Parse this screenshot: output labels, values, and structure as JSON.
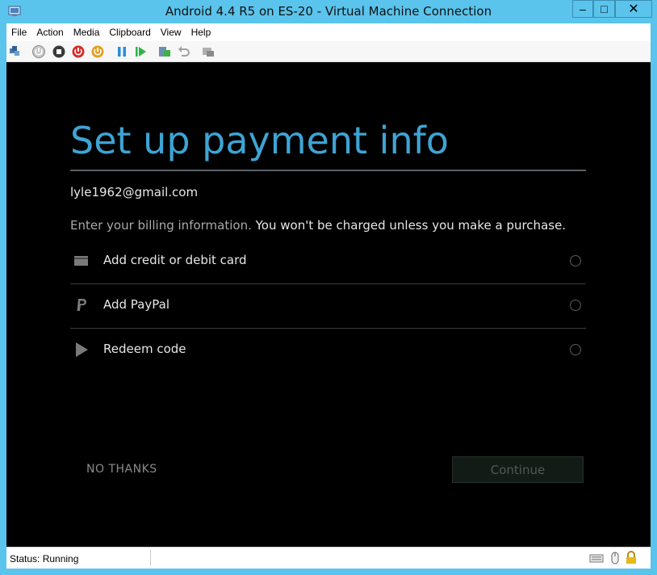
{
  "window": {
    "title": "Android 4.4 R5 on ES-20 - Virtual Machine Connection",
    "minimize_glyph": "–",
    "maximize_glyph": "□",
    "close_glyph": "✕"
  },
  "menu": {
    "items": [
      {
        "label": "File"
      },
      {
        "label": "Action"
      },
      {
        "label": "Media"
      },
      {
        "label": "Clipboard"
      },
      {
        "label": "View"
      },
      {
        "label": "Help"
      }
    ]
  },
  "toolbar": {
    "icons": [
      "ctrl-alt-del-icon",
      "start-icon",
      "turn-off-icon",
      "shutdown-icon",
      "save-icon",
      "pause-icon",
      "resume-icon",
      "checkpoint-icon",
      "revert-icon",
      "enhanced-session-icon"
    ]
  },
  "screen": {
    "title": "Set up payment info",
    "email": "lyle1962@gmail.com",
    "billing_dim": "Enter your billing information.",
    "billing_bright": "You won't be charged unless you make a purchase.",
    "options": [
      {
        "label": "Add credit or debit card",
        "icon": "credit-card-icon",
        "selected": false
      },
      {
        "label": "Add PayPal",
        "icon": "paypal-icon",
        "selected": false
      },
      {
        "label": "Redeem code",
        "icon": "play-store-icon",
        "selected": false
      }
    ],
    "no_thanks": "NO THANKS",
    "continue": "Continue"
  },
  "statusbar": {
    "status": "Status: Running",
    "icons": [
      "keyboard-icon",
      "mouse-icon",
      "lock-icon"
    ]
  },
  "colors": {
    "title_blue": "#3ea4d4",
    "frame": "#5ac4ec",
    "screen_bg": "#000000"
  }
}
